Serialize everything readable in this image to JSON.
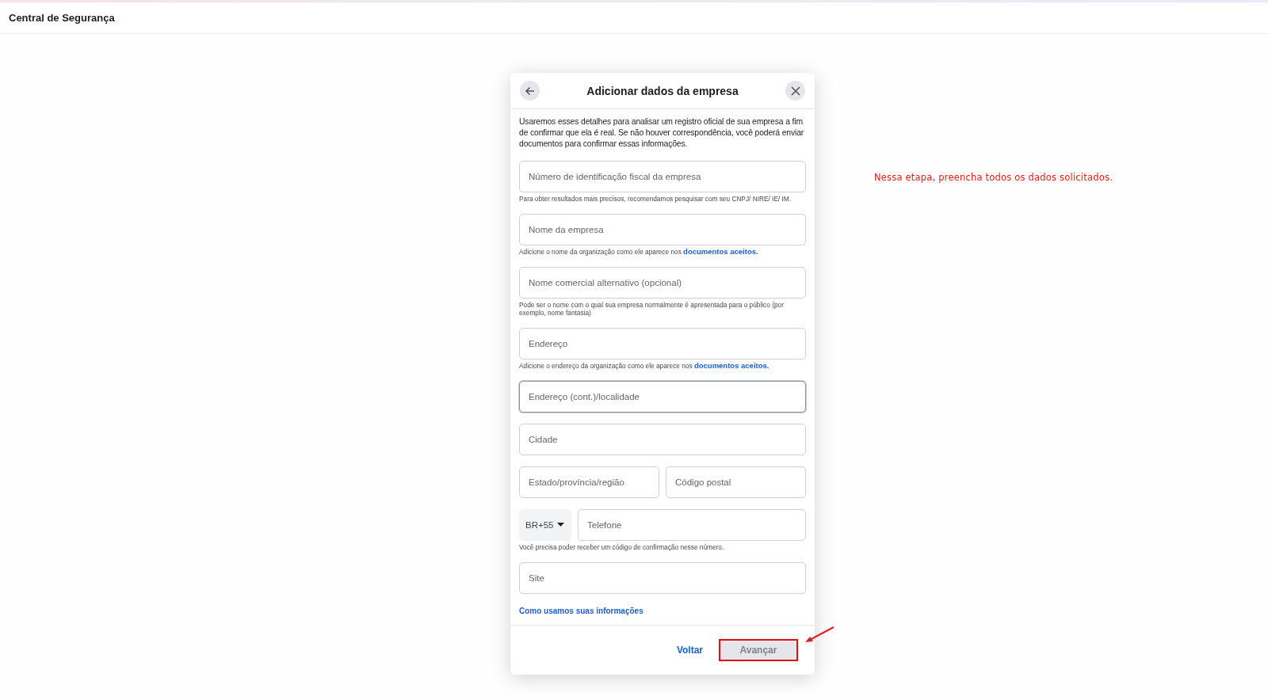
{
  "header": {
    "title": "Central de Segurança"
  },
  "modal": {
    "title": "Adicionar dados da empresa",
    "intro": "Usaremos esses detalhes para analisar um registro oficial de sua empresa a fim de confirmar que ela é real. Se não houver correspondência, você poderá enviar documentos para confirmar essas informações.",
    "fields": [
      {
        "kind": "input",
        "placeholder": "Número de identificação fiscal da empresa",
        "focused": false,
        "hint": "Para obter resultados mais precisos, recomendamos pesquisar com seu CNPJ/ NIRE/ IE/ IM."
      },
      {
        "kind": "input",
        "placeholder": "Nome da empresa",
        "focused": false,
        "hint": "Adicione o nome da organização como ele aparece nos ",
        "hint_link": "documentos aceitos."
      },
      {
        "kind": "input",
        "placeholder": "Nome comercial alternativo (opcional)",
        "focused": false,
        "hint": "Pode ser o nome com o qual sua empresa normalmente é apresentada para o público (por exemplo, nome fantasia)"
      },
      {
        "kind": "input",
        "placeholder": "Endereço",
        "focused": false,
        "hint": "Adicione o endereço da organização como ele aparece nos ",
        "hint_link": "documentos aceitos."
      },
      {
        "kind": "input",
        "placeholder": "Endereço (cont.)/localidade",
        "focused": true
      },
      {
        "kind": "input",
        "placeholder": "Cidade",
        "focused": false
      },
      {
        "kind": "pair",
        "placeholders": [
          "Estado/província/região",
          "Código postal"
        ]
      },
      {
        "kind": "phone",
        "country_code": "BR+55",
        "placeholder": "Telefone",
        "hint": "Você precisa poder receber um código de confirmação nesse número."
      },
      {
        "kind": "input",
        "placeholder": "Site",
        "focused": false
      }
    ],
    "info_link": "Como usamos suas informações",
    "back_button": {
      "label": "Voltar"
    },
    "next_button": {
      "label": "Avançar",
      "disabled": true,
      "highlighted": true
    }
  },
  "annotation": {
    "text": "Nessa etapa, preencha todos os dados solicitados."
  }
}
